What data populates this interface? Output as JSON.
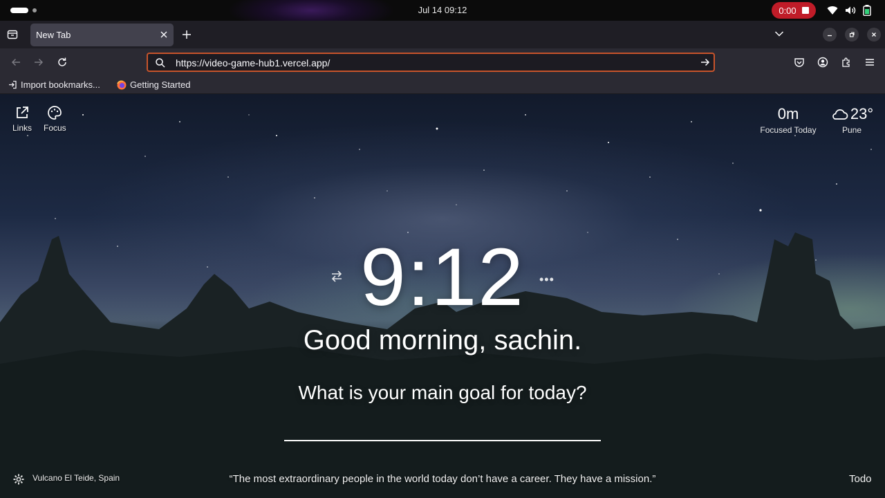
{
  "system": {
    "clock": "Jul 14  09:12",
    "recording_time": "0:00"
  },
  "browser": {
    "tab_title": "New Tab",
    "url": "https://video-game-hub1.vercel.app/",
    "bookmarks": [
      {
        "label": "Import bookmarks..."
      },
      {
        "label": "Getting Started"
      }
    ],
    "accent_color": "#c8542b"
  },
  "momentum": {
    "links_label": "Links",
    "focus_label": "Focus",
    "focused_value": "0m",
    "focused_label": "Focused Today",
    "weather_temp": "23°",
    "weather_location": "Pune",
    "weather_icon": "cloud-icon",
    "time": "9:12",
    "greeting": "Good morning, sachin.",
    "prompt": "What is your main goal for today?",
    "photo_location": "Vulcano El Teide, Spain",
    "quote": "“The most extraordinary people in the world today don’t have a career. They have a mission.”",
    "todo_label": "Todo"
  }
}
